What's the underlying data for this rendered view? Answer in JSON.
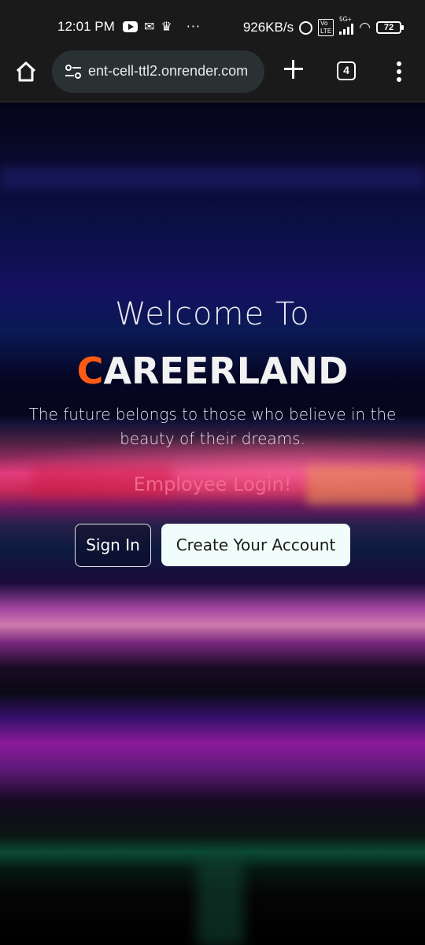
{
  "status_bar": {
    "time": "12:01 PM",
    "speed": "926KB/s",
    "network": "5G+",
    "battery": "72",
    "icons": [
      "youtube-icon",
      "gmail-icon",
      "crown-icon",
      "more-dots-icon",
      "alarm-icon",
      "volte-icon",
      "signal-icon",
      "wifi-icon",
      "battery-icon"
    ]
  },
  "browser": {
    "url": "ent-cell-ttl2.onrender.com",
    "tab_count": "4"
  },
  "hero": {
    "welcome": "Welcome To",
    "brand_first": "C",
    "brand_rest": "AREERLAND",
    "tagline": "The future belongs to those who believe in the beauty of their dreams.",
    "employee_login": "Employee Login!",
    "sign_in": "Sign In",
    "create_account": "Create Your Account"
  },
  "colors": {
    "brand_accent": "#ff5a14",
    "employee_link": "#f2678f",
    "create_button_bg": "#f0fdfa"
  }
}
